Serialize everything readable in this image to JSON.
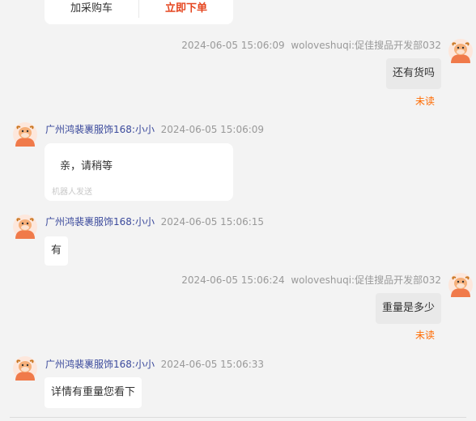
{
  "product_card": {
    "add_cart_label": "加采购车",
    "order_label": "立即下单"
  },
  "messages": [
    {
      "sender": "woloveshuqi:促佳搜品开发部032",
      "time": "2024-06-05 15:06:09",
      "text": "还有货吗",
      "status": "未读"
    },
    {
      "sender": "广州鸿裴裹服饰168:小小",
      "time": "2024-06-05 15:06:09",
      "text": "亲，请稍等",
      "note": "机器人发送"
    },
    {
      "sender": "广州鸿裴裹服饰168:小小",
      "time": "2024-06-05 15:06:15",
      "text": "有"
    },
    {
      "sender": "woloveshuqi:促佳搜品开发部032",
      "time": "2024-06-05 15:06:24",
      "text": "重量是多少",
      "status": "未读"
    },
    {
      "sender": "广州鸿裴裹服饰168:小小",
      "time": "2024-06-05 15:06:33",
      "text": "详情有重量您看下"
    }
  ],
  "colors": {
    "background": "#f3f3f3",
    "link_name": "#3b4a9c",
    "unread": "#ff6a00",
    "order_button": "#e5451f",
    "avatar": "#f07a4a"
  },
  "icons": {
    "avatar": "cow-avatar-icon"
  }
}
